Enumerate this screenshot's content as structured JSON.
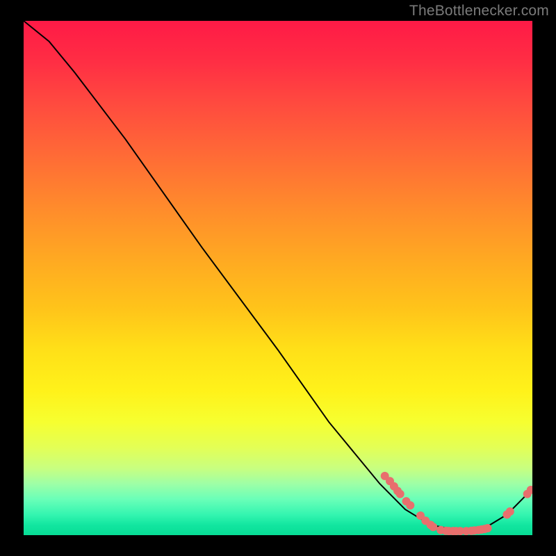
{
  "watermark": "TheBottlenecker.com",
  "chart_data": {
    "type": "line",
    "title": "",
    "xlabel": "",
    "ylabel": "",
    "xlim": [
      0,
      100
    ],
    "ylim": [
      0,
      100
    ],
    "curve": [
      {
        "x": 0,
        "y": 100
      },
      {
        "x": 5,
        "y": 96
      },
      {
        "x": 10,
        "y": 90
      },
      {
        "x": 20,
        "y": 77
      },
      {
        "x": 35,
        "y": 56
      },
      {
        "x": 50,
        "y": 36
      },
      {
        "x": 60,
        "y": 22
      },
      {
        "x": 70,
        "y": 10
      },
      {
        "x": 75,
        "y": 5
      },
      {
        "x": 80,
        "y": 2
      },
      {
        "x": 85,
        "y": 1
      },
      {
        "x": 90,
        "y": 1
      },
      {
        "x": 95,
        "y": 4
      },
      {
        "x": 100,
        "y": 9
      }
    ],
    "markers": [
      {
        "x": 71,
        "y": 11.5
      },
      {
        "x": 72,
        "y": 10.5
      },
      {
        "x": 72.8,
        "y": 9.5
      },
      {
        "x": 73.5,
        "y": 8.6
      },
      {
        "x": 74,
        "y": 8.0
      },
      {
        "x": 75.2,
        "y": 6.6
      },
      {
        "x": 76,
        "y": 5.8
      },
      {
        "x": 78,
        "y": 3.8
      },
      {
        "x": 79,
        "y": 2.8
      },
      {
        "x": 80,
        "y": 2.0
      },
      {
        "x": 80.5,
        "y": 1.6
      },
      {
        "x": 82,
        "y": 1.0
      },
      {
        "x": 83,
        "y": 0.85
      },
      {
        "x": 83.6,
        "y": 0.8
      },
      {
        "x": 84.4,
        "y": 0.8
      },
      {
        "x": 85,
        "y": 0.8
      },
      {
        "x": 85.8,
        "y": 0.8
      },
      {
        "x": 87,
        "y": 0.8
      },
      {
        "x": 88,
        "y": 0.85
      },
      {
        "x": 88.6,
        "y": 0.9
      },
      {
        "x": 89.4,
        "y": 1.0
      },
      {
        "x": 90,
        "y": 1.1
      },
      {
        "x": 90.6,
        "y": 1.2
      },
      {
        "x": 91.2,
        "y": 1.35
      },
      {
        "x": 95,
        "y": 4.0
      },
      {
        "x": 95.6,
        "y": 4.6
      },
      {
        "x": 99,
        "y": 8.0
      },
      {
        "x": 99.7,
        "y": 8.8
      }
    ],
    "marker_color": "#e86f6d",
    "marker_radius": 6,
    "line_color": "#000000",
    "line_width": 2
  }
}
